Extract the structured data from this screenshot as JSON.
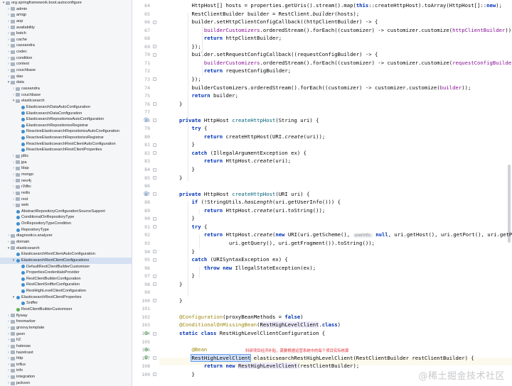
{
  "project_tree": {
    "rows": [
      {
        "depth": 0,
        "tw": "▾",
        "icon": "pkg",
        "label": "org.springframework.boot.autoconfigure"
      },
      {
        "depth": 1,
        "tw": "›",
        "icon": "folder",
        "label": "admin"
      },
      {
        "depth": 1,
        "tw": "›",
        "icon": "folder",
        "label": "amqp"
      },
      {
        "depth": 1,
        "tw": "›",
        "icon": "folder",
        "label": "aop"
      },
      {
        "depth": 1,
        "tw": "›",
        "icon": "folder",
        "label": "availability"
      },
      {
        "depth": 1,
        "tw": "›",
        "icon": "folder",
        "label": "batch"
      },
      {
        "depth": 1,
        "tw": "›",
        "icon": "folder",
        "label": "cache"
      },
      {
        "depth": 1,
        "tw": "›",
        "icon": "folder",
        "label": "cassandra"
      },
      {
        "depth": 1,
        "tw": "›",
        "icon": "folder",
        "label": "codec"
      },
      {
        "depth": 1,
        "tw": "›",
        "icon": "folder",
        "label": "condition"
      },
      {
        "depth": 1,
        "tw": "›",
        "icon": "folder",
        "label": "context"
      },
      {
        "depth": 1,
        "tw": "›",
        "icon": "folder",
        "label": "couchbase"
      },
      {
        "depth": 1,
        "tw": "›",
        "icon": "folder",
        "label": "dao"
      },
      {
        "depth": 1,
        "tw": "▾",
        "icon": "folder",
        "label": "data"
      },
      {
        "depth": 2,
        "tw": "›",
        "icon": "folder",
        "label": "cassandra"
      },
      {
        "depth": 2,
        "tw": "›",
        "icon": "folder",
        "label": "couchbase"
      },
      {
        "depth": 2,
        "tw": "▾",
        "icon": "folder",
        "label": "elasticsearch"
      },
      {
        "depth": 3,
        "tw": "",
        "icon": "class",
        "label": "ElasticsearchDataAutoConfiguration"
      },
      {
        "depth": 3,
        "tw": "",
        "icon": "class",
        "label": "ElasticsearchDataConfiguration"
      },
      {
        "depth": 3,
        "tw": "",
        "icon": "class",
        "label": "ElasticsearchRepositoriesAutoConfiguration"
      },
      {
        "depth": 3,
        "tw": "",
        "icon": "class",
        "label": "ElasticsearchRepositoriesRegistrar"
      },
      {
        "depth": 3,
        "tw": "",
        "icon": "class",
        "label": "ReactiveElasticsearchRepositoriesAutoConfiguration"
      },
      {
        "depth": 3,
        "tw": "",
        "icon": "class",
        "label": "ReactiveElasticsearchRepositoriesRegistrar"
      },
      {
        "depth": 3,
        "tw": "",
        "icon": "class",
        "label": "ReactiveElasticsearchRestClientAutoConfiguration"
      },
      {
        "depth": 3,
        "tw": "",
        "icon": "class",
        "label": "ReactiveElasticsearchRestClientProperties"
      },
      {
        "depth": 2,
        "tw": "›",
        "icon": "folder",
        "label": "jdbc"
      },
      {
        "depth": 2,
        "tw": "›",
        "icon": "folder",
        "label": "jpa"
      },
      {
        "depth": 2,
        "tw": "›",
        "icon": "folder",
        "label": "ldap"
      },
      {
        "depth": 2,
        "tw": "›",
        "icon": "folder",
        "label": "mongo"
      },
      {
        "depth": 2,
        "tw": "›",
        "icon": "folder",
        "label": "neo4j"
      },
      {
        "depth": 2,
        "tw": "›",
        "icon": "folder",
        "label": "r2dbc"
      },
      {
        "depth": 2,
        "tw": "›",
        "icon": "folder",
        "label": "redis"
      },
      {
        "depth": 2,
        "tw": "›",
        "icon": "folder",
        "label": "rest"
      },
      {
        "depth": 2,
        "tw": "›",
        "icon": "folder",
        "label": "web"
      },
      {
        "depth": 2,
        "tw": "",
        "icon": "class",
        "label": "AbstractRepositoryConfigurationSourceSupport"
      },
      {
        "depth": 2,
        "tw": "",
        "icon": "class",
        "label": "ConditionalOnRepositoryType"
      },
      {
        "depth": 2,
        "tw": "",
        "icon": "class",
        "label": "OnRepositoryTypeCondition"
      },
      {
        "depth": 2,
        "tw": "",
        "icon": "class",
        "label": "RepositoryType"
      },
      {
        "depth": 1,
        "tw": "›",
        "icon": "folder",
        "label": "diagnostics.analyzer"
      },
      {
        "depth": 1,
        "tw": "›",
        "icon": "folder",
        "label": "domain"
      },
      {
        "depth": 1,
        "tw": "▾",
        "icon": "folder",
        "label": "elasticsearch"
      },
      {
        "depth": 2,
        "tw": "",
        "icon": "class",
        "label": "ElasticsearchRestClientAutoConfiguration"
      },
      {
        "depth": 2,
        "tw": "▾",
        "icon": "clsopen",
        "label": "ElasticsearchRestClientConfigurations",
        "selected": true
      },
      {
        "depth": 3,
        "tw": "",
        "icon": "class",
        "label": "DefaultRestClientBuilderCustomizer"
      },
      {
        "depth": 3,
        "tw": "",
        "icon": "class",
        "label": "PropertiesCredentialsProvider"
      },
      {
        "depth": 3,
        "tw": "",
        "icon": "class",
        "label": "RestClientBuilderConfiguration"
      },
      {
        "depth": 3,
        "tw": "",
        "icon": "class",
        "label": "RestClientSnifferConfiguration"
      },
      {
        "depth": 3,
        "tw": "",
        "icon": "class",
        "label": "RestHighLevelClientConfiguration"
      },
      {
        "depth": 2,
        "tw": "▾",
        "icon": "class",
        "label": "ElasticsearchRestClientProperties"
      },
      {
        "depth": 3,
        "tw": "",
        "icon": "class",
        "label": "Sniffer"
      },
      {
        "depth": 2,
        "tw": "",
        "icon": "iface",
        "label": "RestClientBuilderCustomizer"
      },
      {
        "depth": 1,
        "tw": "›",
        "icon": "folder",
        "label": "flyway"
      },
      {
        "depth": 1,
        "tw": "›",
        "icon": "folder",
        "label": "freemarker"
      },
      {
        "depth": 1,
        "tw": "›",
        "icon": "folder",
        "label": "groovy.template"
      },
      {
        "depth": 1,
        "tw": "›",
        "icon": "folder",
        "label": "gson"
      },
      {
        "depth": 1,
        "tw": "›",
        "icon": "folder",
        "label": "h2"
      },
      {
        "depth": 1,
        "tw": "›",
        "icon": "folder",
        "label": "hateoas"
      },
      {
        "depth": 1,
        "tw": "›",
        "icon": "folder",
        "label": "hazelcast"
      },
      {
        "depth": 1,
        "tw": "›",
        "icon": "folder",
        "label": "http"
      },
      {
        "depth": 1,
        "tw": "›",
        "icon": "folder",
        "label": "influx"
      },
      {
        "depth": 1,
        "tw": "›",
        "icon": "folder",
        "label": "info"
      },
      {
        "depth": 1,
        "tw": "›",
        "icon": "folder",
        "label": "integration"
      },
      {
        "depth": 1,
        "tw": "›",
        "icon": "folder",
        "label": "jackson"
      }
    ]
  },
  "editor": {
    "lines": [
      {
        "n": "64",
        "tokens": [
          [
            "    HttpHost[] hosts = properties.getUris().stream().map(",
            ""
          ],
          [
            "this",
            "kw"
          ],
          [
            "::createHttpHost).toArray(HttpHost[]::",
            ""
          ],
          [
            "new",
            "kw"
          ],
          [
            ");",
            ""
          ]
        ]
      },
      {
        "n": "65",
        "tokens": [
          [
            "    RestClientBuilder builder = RestClient.",
            ""
          ],
          [
            "builder",
            "it"
          ],
          [
            "(hosts);",
            ""
          ]
        ]
      },
      {
        "n": "66",
        "tokens": [
          [
            "    builder.setHttpClientConfigCallback((httpClientBuilder) -> {",
            ""
          ]
        ]
      },
      {
        "n": "67",
        "tokens": [
          [
            "        ",
            ""
          ],
          [
            "builderCustomizers",
            "pl"
          ],
          [
            ".orderedStream().forEach((customizer) -> customizer.customize(",
            ""
          ],
          [
            "httpClientBuilder",
            "pl"
          ],
          [
            "));",
            ""
          ]
        ]
      },
      {
        "n": "68",
        "tokens": [
          [
            "        ",
            ""
          ],
          [
            "return",
            "kw"
          ],
          [
            " httpClientBuilder;",
            ""
          ]
        ]
      },
      {
        "n": "69",
        "tokens": [
          [
            "    });",
            ""
          ]
        ]
      },
      {
        "n": "70",
        "tokens": [
          [
            "    builder.setRequestConfigCallback((requestConfigBuilder) -> {",
            ""
          ]
        ]
      },
      {
        "n": "71",
        "tokens": [
          [
            "        ",
            ""
          ],
          [
            "builderCustomizers",
            "pl"
          ],
          [
            ".orderedStream().forEach((customizer) -> customizer.customize(",
            ""
          ],
          [
            "requestConfigBuilder",
            "pl"
          ],
          [
            "));",
            ""
          ]
        ]
      },
      {
        "n": "72",
        "tokens": [
          [
            "        ",
            ""
          ],
          [
            "return",
            "kw"
          ],
          [
            " requestConfigBuilder;",
            ""
          ]
        ]
      },
      {
        "n": "73",
        "tokens": [
          [
            "    });",
            ""
          ]
        ]
      },
      {
        "n": "74",
        "tokens": [
          [
            "    builderCustomizers.orderedStream().forEach((customizer) -> customizer.customize(",
            ""
          ],
          [
            "builder",
            "pl"
          ],
          [
            "));",
            ""
          ]
        ]
      },
      {
        "n": "75",
        "tokens": [
          [
            "    ",
            ""
          ],
          [
            "return",
            "kw"
          ],
          [
            " builder;",
            ""
          ]
        ]
      },
      {
        "n": "76",
        "tokens": [
          [
            "}",
            ""
          ]
        ]
      },
      {
        "n": "77",
        "tokens": []
      },
      {
        "n": "78",
        "tokens": [
          [
            "",
            ""
          ],
          [
            "private",
            "kw"
          ],
          [
            " HttpHost ",
            ""
          ],
          [
            "createHttpHost",
            "fn"
          ],
          [
            "(String uri) {",
            ""
          ]
        ]
      },
      {
        "n": "79",
        "tokens": [
          [
            "    ",
            ""
          ],
          [
            "try",
            "kw"
          ],
          [
            " {",
            ""
          ]
        ]
      },
      {
        "n": "80",
        "tokens": [
          [
            "        ",
            ""
          ],
          [
            "return",
            "kw"
          ],
          [
            " createHttpHost(URI.",
            ""
          ],
          [
            "create",
            "it"
          ],
          [
            "(uri));",
            ""
          ]
        ]
      },
      {
        "n": "81",
        "tokens": [
          [
            "    }",
            ""
          ]
        ]
      },
      {
        "n": "82",
        "tokens": [
          [
            "    ",
            ""
          ],
          [
            "catch",
            "kw"
          ],
          [
            " (IllegalArgumentException ex) {",
            ""
          ]
        ]
      },
      {
        "n": "83",
        "tokens": [
          [
            "        ",
            ""
          ],
          [
            "return",
            "kw"
          ],
          [
            " HttpHost.",
            ""
          ],
          [
            "create",
            "it"
          ],
          [
            "(uri);",
            ""
          ]
        ]
      },
      {
        "n": "84",
        "tokens": [
          [
            "    }",
            ""
          ]
        ]
      },
      {
        "n": "85",
        "tokens": [
          [
            "}",
            ""
          ]
        ]
      },
      {
        "n": "86",
        "tokens": []
      },
      {
        "n": "87",
        "tokens": [
          [
            "",
            ""
          ],
          [
            "private",
            "kw"
          ],
          [
            " HttpHost ",
            ""
          ],
          [
            "createHttpHost",
            "fn"
          ],
          [
            "(URI uri) {",
            ""
          ]
        ]
      },
      {
        "n": "88",
        "tokens": [
          [
            "    ",
            ""
          ],
          [
            "if",
            "kw"
          ],
          [
            " (!StringUtils.",
            ""
          ],
          [
            "hasLength",
            "it"
          ],
          [
            "(uri.getUserInfo())) {",
            ""
          ]
        ]
      },
      {
        "n": "89",
        "tokens": [
          [
            "        ",
            ""
          ],
          [
            "return",
            "kw"
          ],
          [
            " HttpHost.",
            ""
          ],
          [
            "create",
            "it"
          ],
          [
            "(uri.toString());",
            ""
          ]
        ]
      },
      {
        "n": "90",
        "tokens": [
          [
            "    }",
            ""
          ]
        ]
      },
      {
        "n": "91",
        "tokens": [
          [
            "    ",
            ""
          ],
          [
            "try",
            "kw"
          ],
          [
            " {",
            ""
          ]
        ]
      },
      {
        "n": "92",
        "tokens": [
          [
            "        ",
            ""
          ],
          [
            "return",
            "kw"
          ],
          [
            " HttpHost.",
            ""
          ],
          [
            "create",
            "it"
          ],
          [
            "(",
            ""
          ],
          [
            "new",
            "kw"
          ],
          [
            " URI(uri.getScheme(), ",
            ""
          ],
          [
            "userInfo:",
            "hint"
          ],
          [
            " ",
            ""
          ],
          [
            "null",
            "kw"
          ],
          [
            ", uri.getHost(), uri.getPort(), uri.getPath(),",
            ""
          ]
        ]
      },
      {
        "n": "93",
        "tokens": [
          [
            "                uri.getQuery(), uri.getFragment()).toString());",
            ""
          ]
        ]
      },
      {
        "n": "94",
        "tokens": [
          [
            "    }",
            ""
          ]
        ]
      },
      {
        "n": "95",
        "tokens": [
          [
            "    ",
            ""
          ],
          [
            "catch",
            "kw"
          ],
          [
            " (URISyntaxException ex) {",
            ""
          ]
        ]
      },
      {
        "n": "96",
        "tokens": [
          [
            "        ",
            ""
          ],
          [
            "throw",
            "kw"
          ],
          [
            " ",
            ""
          ],
          [
            "new",
            "kw"
          ],
          [
            " IllegalStateException(ex);",
            ""
          ]
        ]
      },
      {
        "n": "97",
        "tokens": [
          [
            "    }",
            ""
          ]
        ]
      },
      {
        "n": "98",
        "tokens": [
          [
            "}",
            ""
          ]
        ]
      },
      {
        "n": "99",
        "tokens": []
      },
      {
        "n": "100",
        "tokens": [
          [
            "}",
            ""
          ]
        ]
      },
      {
        "n": "101",
        "tokens": []
      },
      {
        "n": "102",
        "tokens": [
          [
            "@Configuration",
            "an"
          ],
          [
            "(proxyBeanMethods = ",
            ""
          ],
          [
            "false",
            "kw"
          ],
          [
            ")",
            ""
          ]
        ]
      },
      {
        "n": "103",
        "tokens": [
          [
            "@ConditionalOnMissingBean",
            "an"
          ],
          [
            "(",
            ""
          ],
          [
            "RestHighLevelClient",
            "hl"
          ],
          [
            ".",
            ""
          ],
          [
            "class",
            "kw"
          ],
          [
            ")",
            ""
          ]
        ]
      },
      {
        "n": "104",
        "tokens": [
          [
            "",
            ""
          ],
          [
            "static",
            "kw"
          ],
          [
            " ",
            ""
          ],
          [
            "class",
            "kw"
          ],
          [
            " RestHighLevelClientConfiguration {",
            ""
          ]
        ]
      },
      {
        "n": "105",
        "tokens": []
      },
      {
        "n": "106",
        "tokens": [
          [
            "    ",
            ""
          ],
          [
            "@Bean",
            "an"
          ]
        ]
      },
      {
        "n": "107",
        "tokens": [
          [
            "    ",
            ""
          ],
          [
            "RestHighLevelClient",
            "sel"
          ],
          [
            " elasticsearchRestHighLevelClient(RestClientBuilder restClientBuilder) {",
            ""
          ]
        ]
      },
      {
        "n": "108",
        "tokens": [
          [
            "        ",
            ""
          ],
          [
            "return",
            "kw"
          ],
          [
            " ",
            ""
          ],
          [
            "new",
            "kw"
          ],
          [
            " ",
            ""
          ],
          [
            "RestHighLevelClient",
            "hl"
          ],
          [
            "(restClientBuilder);",
            ""
          ]
        ]
      },
      {
        "n": "109",
        "tokens": [
          [
            "    }",
            ""
          ]
        ]
      }
    ],
    "annotation_note": "科研项目经济补贴，需要根据运营系统中的每个项目实际核算",
    "watermark": "@稀土掘金技术社区"
  }
}
